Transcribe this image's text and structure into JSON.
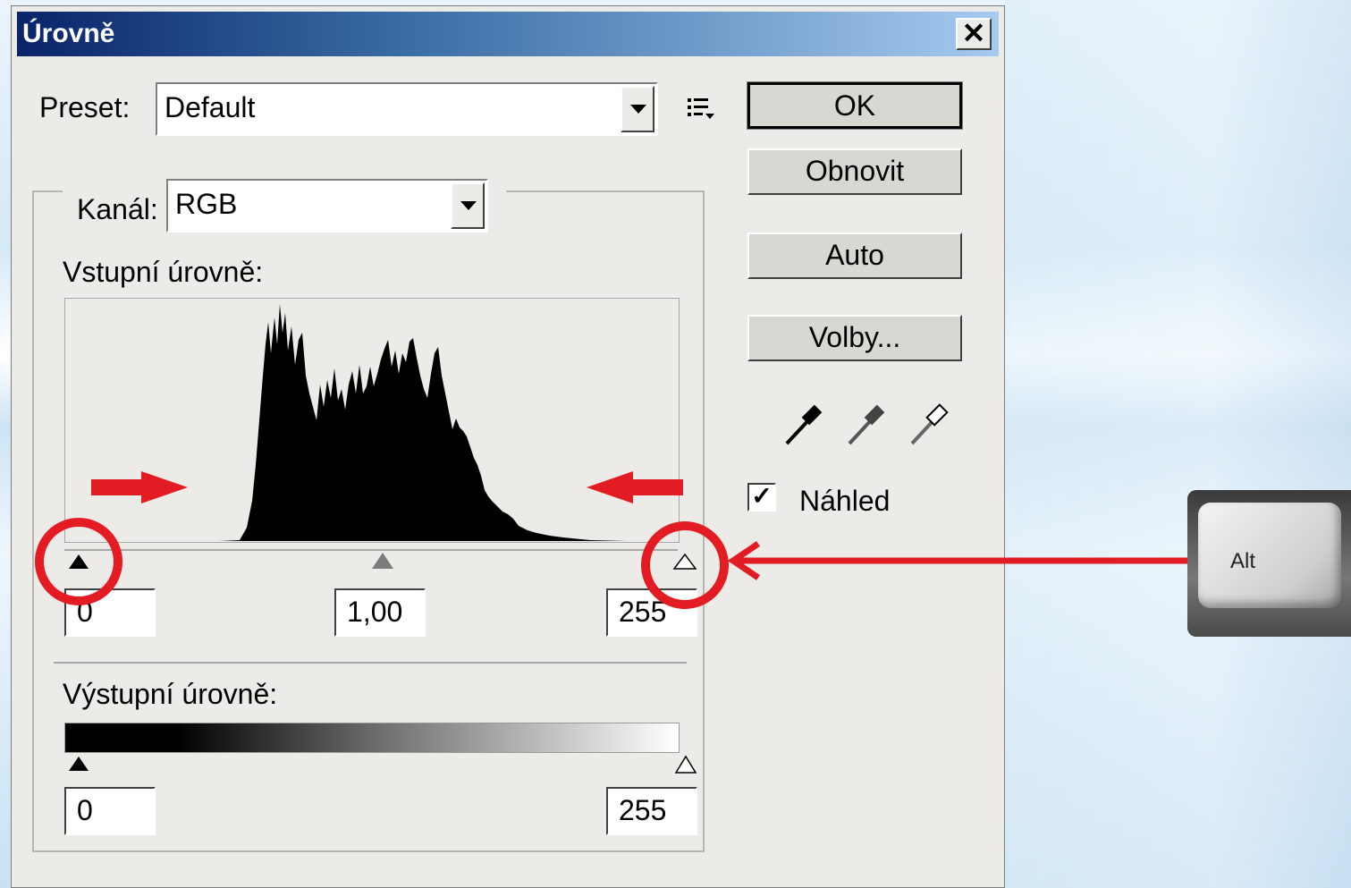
{
  "dialog": {
    "title": "Úrovně",
    "close": "✕",
    "preset_label": "Preset:",
    "preset_value": "Default",
    "channel_label": "Kanál:",
    "channel_value": "RGB",
    "input_levels_label": "Vstupní úrovně:",
    "input_black": "0",
    "input_gamma": "1,00",
    "input_white": "255",
    "output_levels_label": "Výstupní úrovně:",
    "output_black": "0",
    "output_white": "255",
    "buttons": {
      "ok": "OK",
      "reset": "Obnovit",
      "auto": "Auto",
      "options": "Volby..."
    },
    "preview_label": "Náhled",
    "preview_checked": "✓"
  },
  "key": {
    "label": "Alt"
  },
  "colors": {
    "accent_red": "#e31b23",
    "title_start": "#0a246a",
    "title_end": "#a6caf0"
  },
  "icons": [
    "preset-menu-icon",
    "black-eyedropper-icon",
    "gray-eyedropper-icon",
    "white-eyedropper-icon",
    "arrow-right-icon",
    "arrow-left-icon"
  ]
}
